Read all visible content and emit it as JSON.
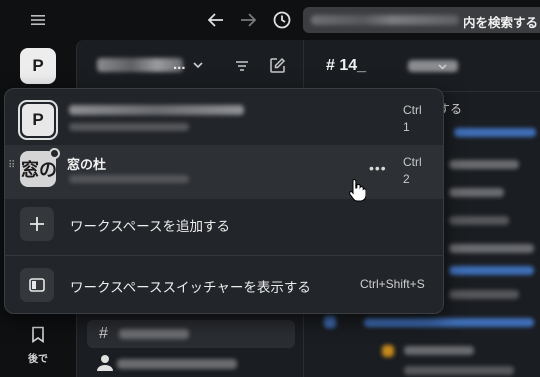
{
  "search": {
    "suffix": "内を検索する"
  },
  "rail": {
    "workspace_initial": "P",
    "later_label": "後で"
  },
  "sidebar": {
    "title_suffix": "..."
  },
  "channel": {
    "name": "# 14_"
  },
  "peek": {
    "text": "する"
  },
  "switcher": {
    "workspaces": [
      {
        "initial": "P",
        "name": "",
        "shortcut_line1": "Ctrl",
        "shortcut_line2": "1"
      },
      {
        "initial": "窓の",
        "name": "窓の杜",
        "shortcut_line1": "Ctrl",
        "shortcut_line2": "2",
        "more": "•••"
      }
    ],
    "add_label": "ワークスペースを追加する",
    "show_switcher_label": "ワークスペーススイッチャーを表示する",
    "show_switcher_shortcut": "Ctrl+Shift+S"
  }
}
